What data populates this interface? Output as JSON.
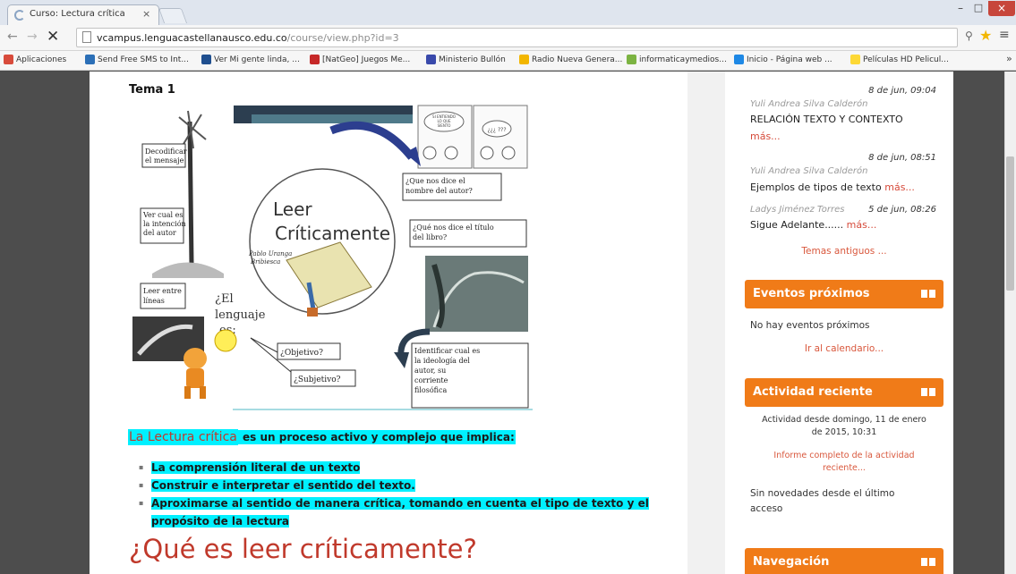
{
  "browser": {
    "tab_title": "Curso: Lectura crítica",
    "tab_close": "×",
    "url_host": "vcampus.lenguacastellanausco.edu.co",
    "url_path": "/course/view.php?id=3",
    "window_min": "–",
    "window_max": "□",
    "window_close": "×"
  },
  "bookmarks": [
    {
      "label": "Aplicaciones",
      "color": "#d84b3b"
    },
    {
      "label": "Send Free SMS to Int...",
      "color": "#2b6fb7"
    },
    {
      "label": "Ver Mi gente linda, ...",
      "color": "#1f4f8f"
    },
    {
      "label": "[NatGeo] Juegos Me...",
      "color": "#c62828"
    },
    {
      "label": "Ministerio Bullón",
      "color": "#3949ab"
    },
    {
      "label": "Radio Nueva Genera...",
      "color": "#f2b600"
    },
    {
      "label": "informaticaymedios...",
      "color": "#7cb342"
    },
    {
      "label": "Inicio - Página web ...",
      "color": "#1e88e5"
    },
    {
      "label": "Películas HD Pelicul...",
      "color": "#fdd835"
    }
  ],
  "bookmarks_more": "»",
  "main": {
    "topic_title": "Tema 1",
    "infographic": {
      "center_title_1": "Leer",
      "center_title_2": "Críticamente",
      "author": "Pablo Uranga",
      "author_2": "Bribiesca",
      "box_decode_1": "Decodificar",
      "box_decode_2": "el mensaje",
      "box_intention_1": "Ver cual es",
      "box_intention_2": "la intención",
      "box_intention_3": "del autor",
      "box_between_1": "Leer entre",
      "box_between_2": "líneas",
      "box_author_name_1": "¿Que nos dice el",
      "box_author_name_2": "nombre del autor?",
      "box_title_1": "¿Qué nos dice el título",
      "box_title_2": "del libro?",
      "language_1": "¿El",
      "language_2": "lenguaje",
      "language_3": "es:",
      "box_objective": "¿Objetivo?",
      "box_subjective": "¿Subjetivo?",
      "box_ideology_1": "Identificar cual es",
      "box_ideology_2": "la ideología del",
      "box_ideology_3": "autor, su",
      "box_ideology_4": "corriente",
      "box_ideology_5": "filosófica",
      "comic_1": "SI ENTIENDO",
      "comic_2": "LO QUE",
      "comic_3": "SIENTO",
      "comic_4": "¿¿¿ ???"
    },
    "intro_highlight": "La Lectura crítica",
    "intro_rest": " es un proceso activo y complejo que implica:",
    "bullets": [
      "La comprensión literal de un texto",
      "Construir e interpretar el sentido del texto.",
      "Aproximarse al sentido de manera crítica, tomando en cuenta el tipo de texto y el",
      "propósito de la lectura"
    ],
    "section_heading": "¿Qué es leer críticamente?"
  },
  "sidebar": {
    "posts": [
      {
        "date": "8 de jun, 09:04",
        "author": "Yuli Andrea Silva Calderón",
        "title": "RELACIÓN TEXTO Y CONTEXTO",
        "more": "más..."
      },
      {
        "date": "8 de jun, 08:51",
        "author": "Yuli Andrea Silva Calderón",
        "title": "Ejemplos de tipos de texto",
        "more": "más..."
      },
      {
        "date": "5 de jun, 08:26",
        "author": "Ladys Jiménez Torres",
        "title": "Sigue Adelante......",
        "more": "más..."
      }
    ],
    "older_topics": "Temas antiguos ...",
    "events_header": "Eventos próximos",
    "events_none": "No hay eventos próximos",
    "events_calendar": "Ir al calendario...",
    "activity_header": "Actividad reciente",
    "activity_since_1": "Actividad desde domingo, 11 de enero",
    "activity_since_2": "de 2015, 10:31",
    "activity_report_1": "Informe completo de la actividad",
    "activity_report_2": "reciente...",
    "activity_none_1": "Sin novedades desde el último",
    "activity_none_2": "acceso",
    "nav_header": "Navegación"
  },
  "colors": {
    "accent_orange": "#f07b18",
    "highlight_cyan": "#00f0ff",
    "heading_red": "#c0392b"
  }
}
